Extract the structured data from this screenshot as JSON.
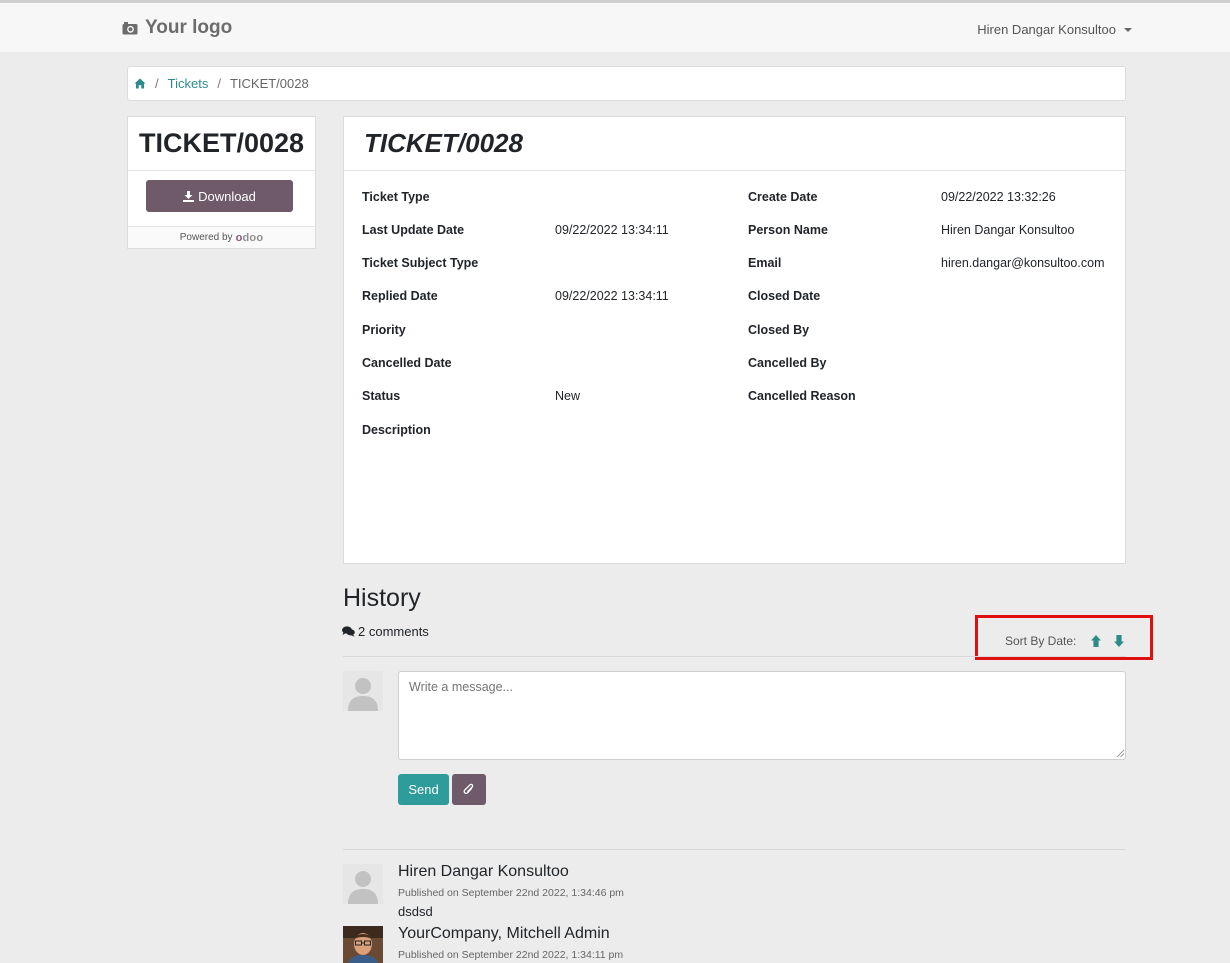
{
  "header": {
    "logo_text": "Your logo",
    "user_name": "Hiren Dangar Konsultoo"
  },
  "breadcrumb": {
    "home_icon": "home-icon",
    "items": [
      "Tickets",
      "TICKET/0028"
    ]
  },
  "sidebar_card": {
    "title": "TICKET/0028",
    "download_label": "Download",
    "powered_by_label": "Powered by",
    "brand_o": "o",
    "brand_rest": "doo"
  },
  "ticket": {
    "title": "TICKET/0028",
    "left_fields": [
      {
        "label": "Ticket Type",
        "value": ""
      },
      {
        "label": "Last Update Date",
        "value": "09/22/2022 13:34:11"
      },
      {
        "label": "Ticket Subject Type",
        "value": ""
      },
      {
        "label": "Replied Date",
        "value": "09/22/2022 13:34:11"
      },
      {
        "label": "Priority",
        "value": ""
      },
      {
        "label": "Cancelled Date",
        "value": ""
      },
      {
        "label": "Status",
        "value": "New"
      },
      {
        "label": "Description",
        "value": ""
      }
    ],
    "right_fields": [
      {
        "label": "Create Date",
        "value": "09/22/2022 13:32:26"
      },
      {
        "label": "Person Name",
        "value": "Hiren Dangar Konsultoo"
      },
      {
        "label": "Email",
        "value": "hiren.dangar@konsultoo.com"
      },
      {
        "label": "Closed Date",
        "value": ""
      },
      {
        "label": "Closed By",
        "value": ""
      },
      {
        "label": "Cancelled By",
        "value": ""
      },
      {
        "label": "Cancelled Reason",
        "value": ""
      }
    ]
  },
  "history": {
    "title": "History",
    "comments_count": "2 comments",
    "sort_label": "Sort By Date:",
    "message_placeholder": "Write a message...",
    "send_label": "Send",
    "messages": [
      {
        "author": "Hiren Dangar Konsultoo",
        "published": "Published on September 22nd 2022, 1:34:46 pm",
        "body": "dsdsd"
      },
      {
        "author": "YourCompany, Mitchell Admin",
        "published": "Published on September 22nd 2022, 1:34:11 pm",
        "body": ""
      }
    ]
  },
  "colors": {
    "accent": "#2e8b8b",
    "button_primary": "#6f5a6a",
    "send_button": "#2f9c9c",
    "highlight": "#e01010"
  }
}
